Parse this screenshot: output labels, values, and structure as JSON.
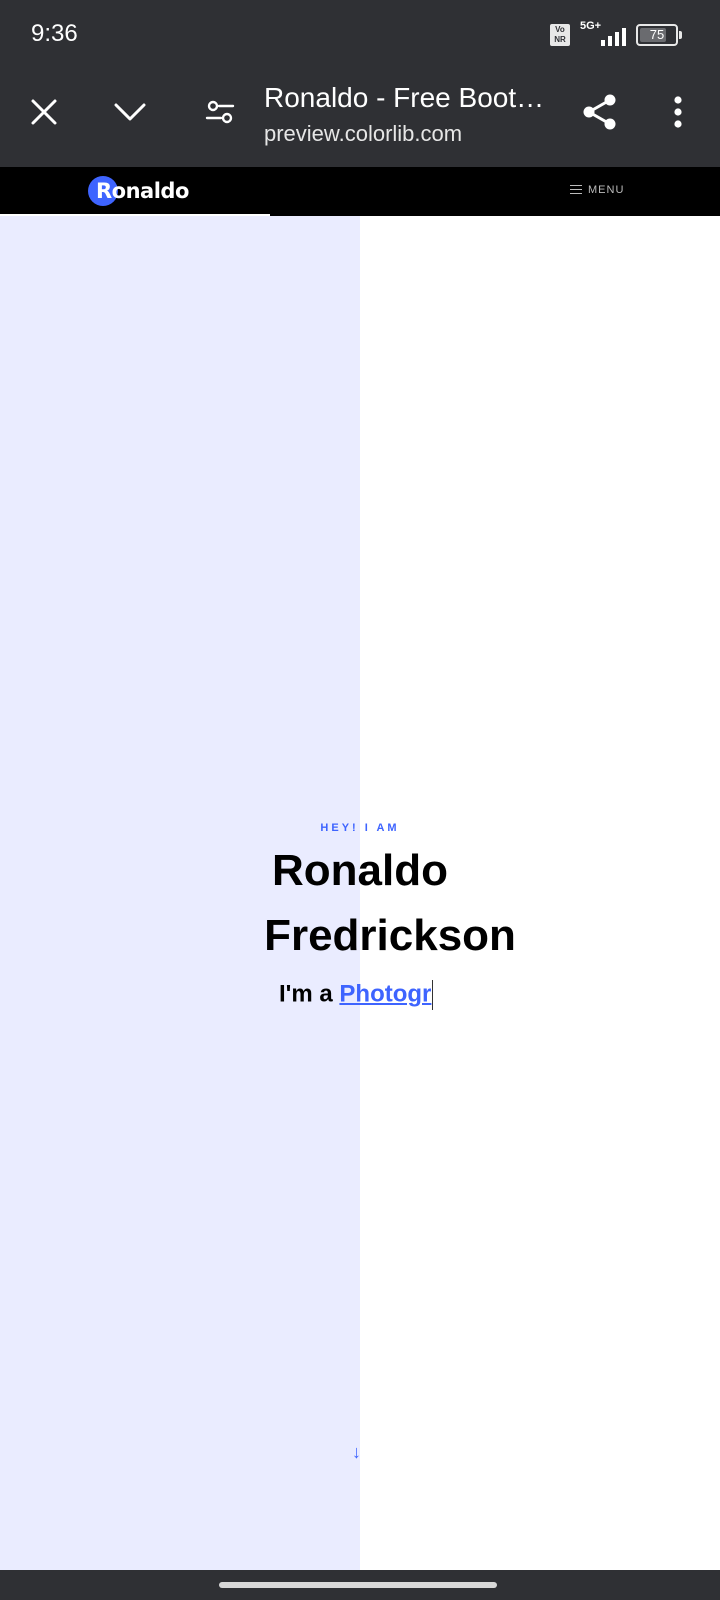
{
  "status_bar": {
    "time": "9:36",
    "volte_label": "Vo\nNR",
    "network_label": "5G+",
    "battery_level": "75",
    "battery_fraction": 0.75
  },
  "browser": {
    "page_title": "Ronaldo - Free Boots…",
    "url": "preview.colorlib.com",
    "icons": [
      "close-icon",
      "chevron-down-icon",
      "tune-icon",
      "share-icon",
      "more-vertical-icon"
    ]
  },
  "site_nav": {
    "logo_text": "Ronaldo",
    "menu_label": "MENU"
  },
  "hero": {
    "eyebrow": "HEY! I AM",
    "name_line1": "Ronaldo",
    "name_line2": "Fredrickson",
    "role_prefix": "I'm a ",
    "role_typed": "Photogr",
    "scroll_icon": "arrow-down-icon"
  },
  "colors": {
    "accent": "#3e64ff",
    "hero_left_bg": "#eaecff",
    "system_bar_bg": "#2f3034",
    "nav_bg": "#000000"
  }
}
